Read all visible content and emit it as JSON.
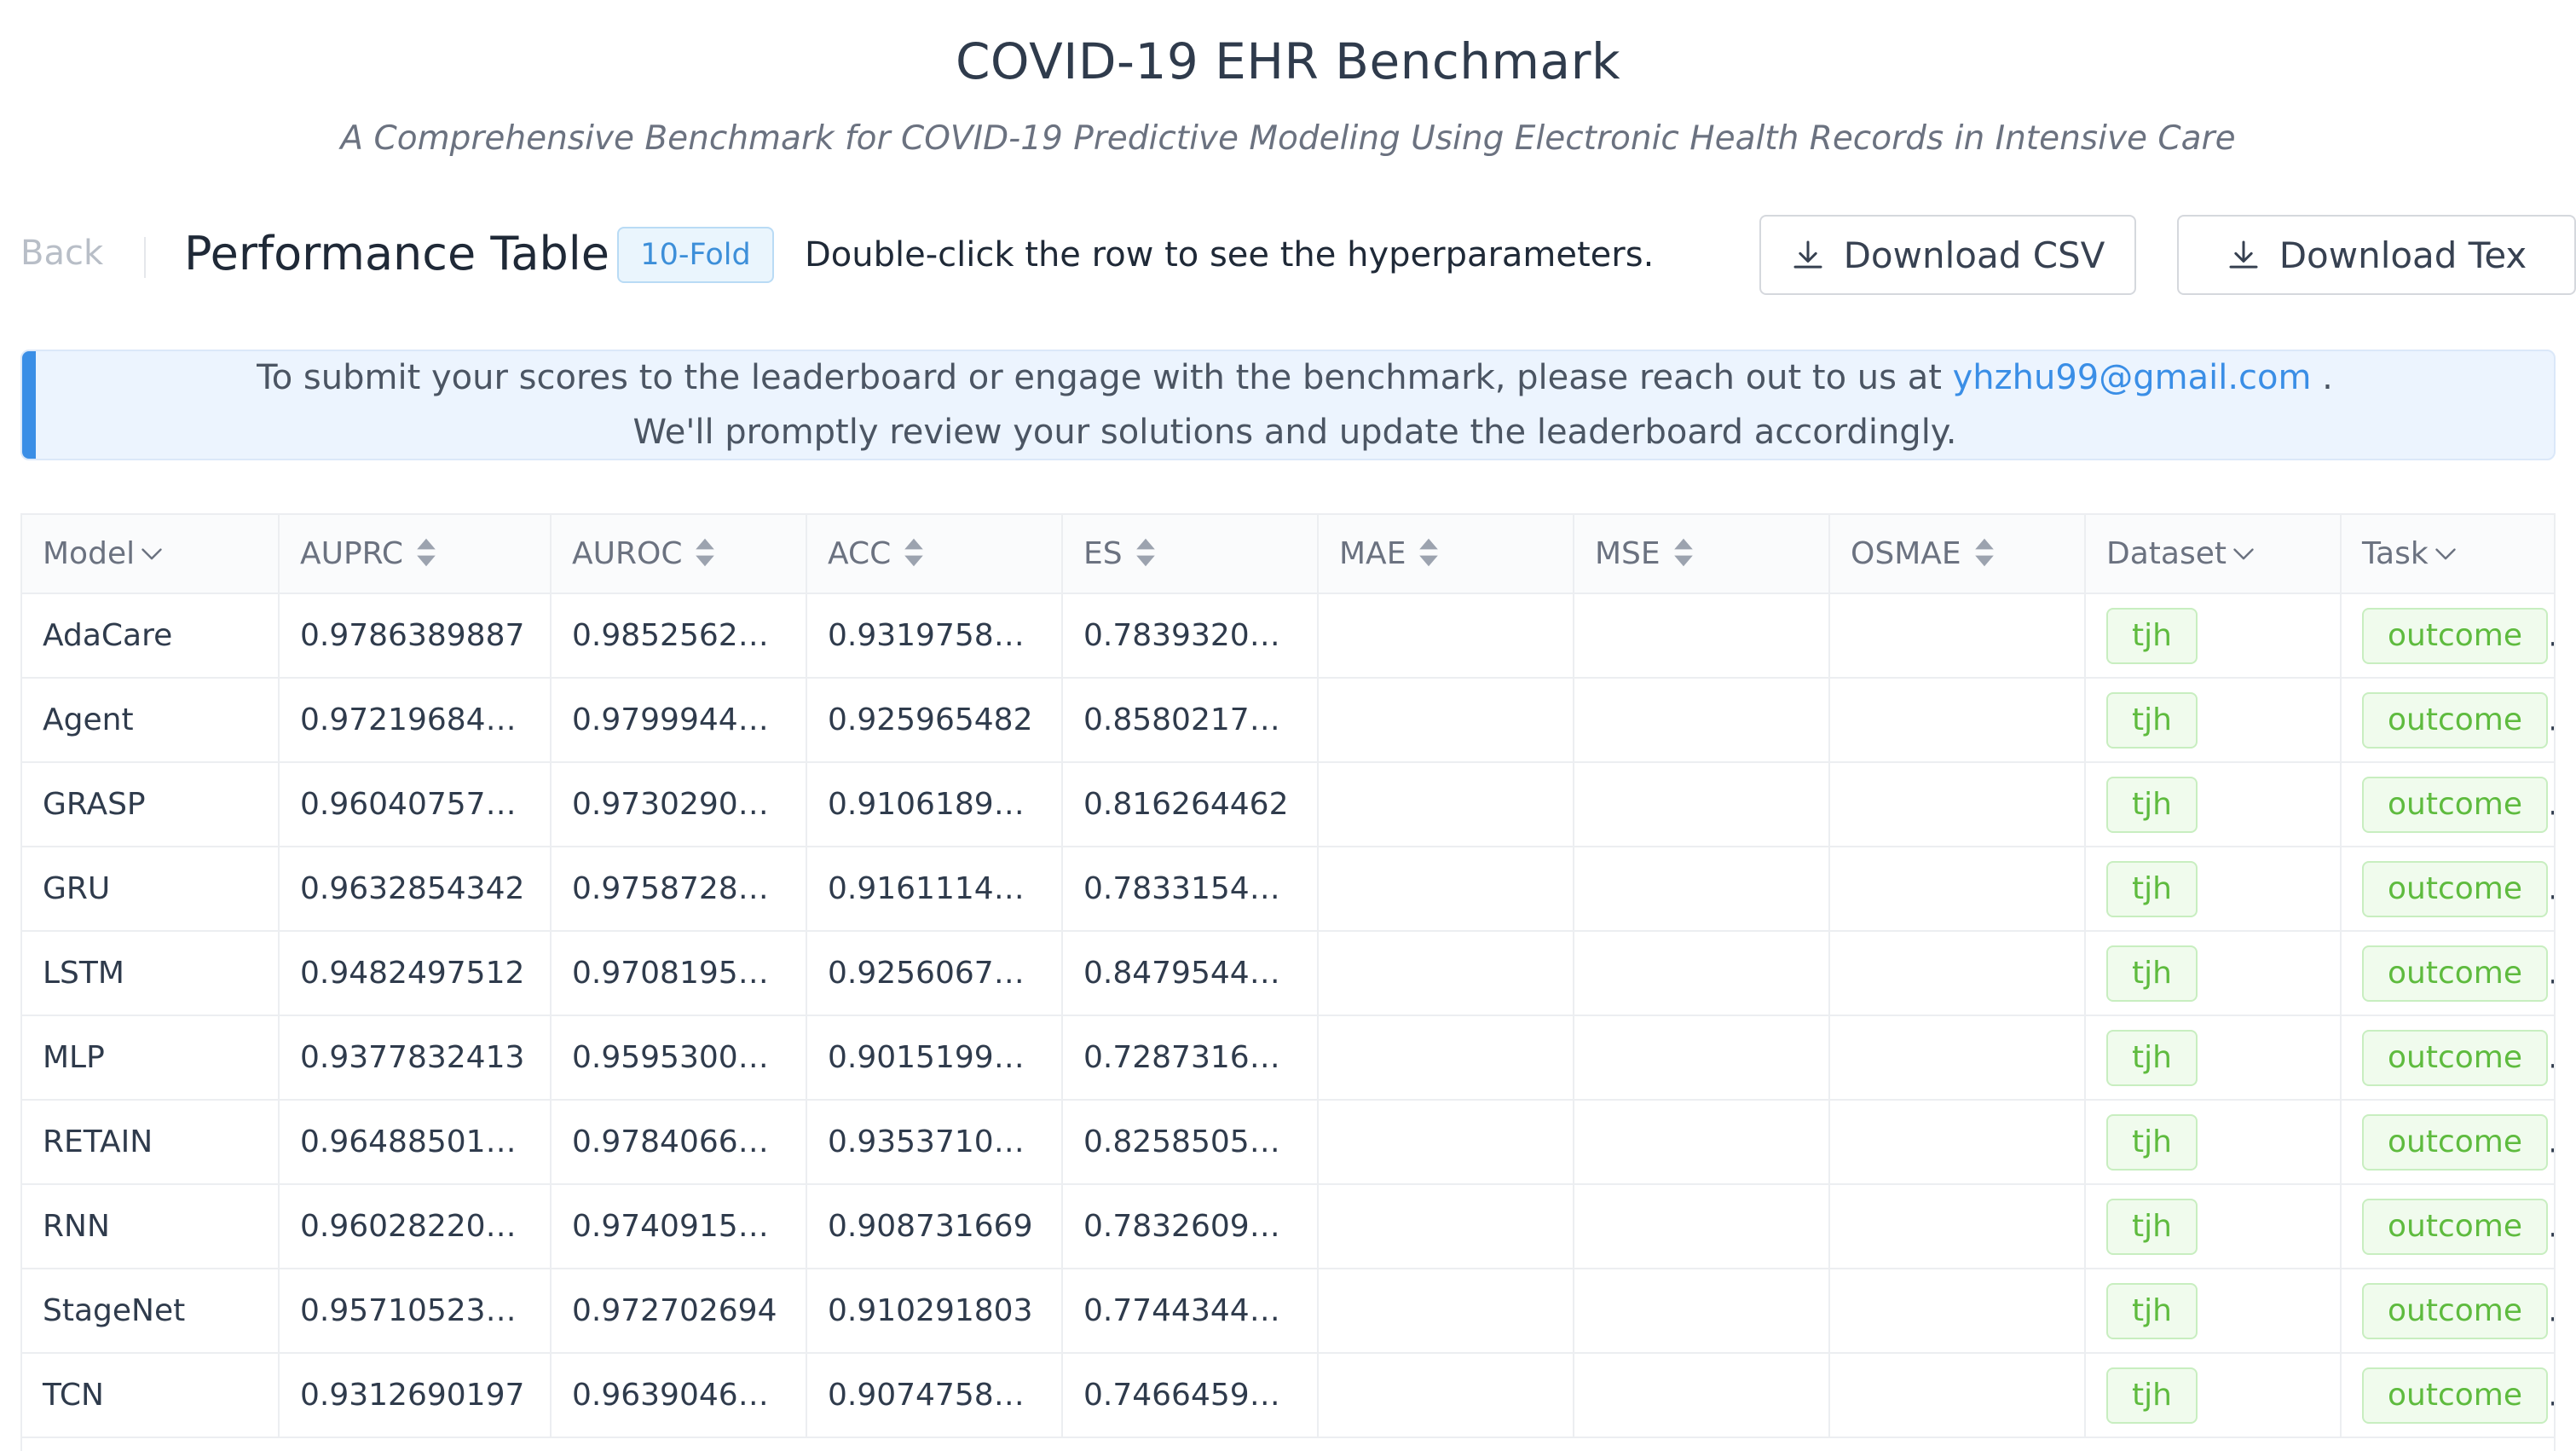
{
  "header": {
    "title": "COVID-19 EHR Benchmark",
    "subtitle": "A Comprehensive Benchmark for COVID-19 Predictive Modeling Using Electronic Health Records in Intensive Care"
  },
  "toolbar": {
    "back_label": "Back",
    "page_title": "Performance Table",
    "fold_badge": "10-Fold",
    "hint": "Double-click the row to see the hyperparameters.",
    "download_csv": "Download CSV",
    "download_tex": "Download Tex"
  },
  "notice": {
    "line1_prefix": "To submit your scores to the leaderboard or engage with the benchmark, please reach out to us at",
    "email": "yhzhu99@gmail.com",
    "line1_suffix": " .",
    "line2": "We'll promptly review your solutions and update the leaderboard accordingly."
  },
  "table": {
    "columns": [
      {
        "label": "Model",
        "control": "filter"
      },
      {
        "label": "AUPRC",
        "control": "sort"
      },
      {
        "label": "AUROC",
        "control": "sort"
      },
      {
        "label": "ACC",
        "control": "sort"
      },
      {
        "label": "ES",
        "control": "sort"
      },
      {
        "label": "MAE",
        "control": "sort"
      },
      {
        "label": "MSE",
        "control": "sort"
      },
      {
        "label": "OSMAE",
        "control": "sort"
      },
      {
        "label": "Dataset",
        "control": "filter"
      },
      {
        "label": "Task",
        "control": "filter"
      }
    ],
    "rows": [
      {
        "model": "AdaCare",
        "auprc": "0.9786389887",
        "auroc": "0.98525629...",
        "acc": "0.931975859...",
        "es": "0.783932087...",
        "mae": "",
        "mse": "",
        "osmae": "",
        "dataset": "tjh",
        "task": "outcome"
      },
      {
        "model": "Agent",
        "auprc": "0.9721968413...",
        "auroc": "0.979994475...",
        "acc": "0.925965482",
        "es": "0.8580217808",
        "mae": "",
        "mse": "",
        "osmae": "",
        "dataset": "tjh",
        "task": "outcome"
      },
      {
        "model": "GRASP",
        "auprc": "0.960407572...",
        "auroc": "0.97302908...",
        "acc": "0.9106189788",
        "es": "0.816264462",
        "mae": "",
        "mse": "",
        "osmae": "",
        "dataset": "tjh",
        "task": "outcome"
      },
      {
        "model": "GRU",
        "auprc": "0.9632854342",
        "auroc": "0.975872808...",
        "acc": "0.9161114095",
        "es": "0.7833154328",
        "mae": "",
        "mse": "",
        "osmae": "",
        "dataset": "tjh",
        "task": "outcome"
      },
      {
        "model": "LSTM",
        "auprc": "0.9482497512",
        "auroc": "0.970819514...",
        "acc": "0.92560674...",
        "es": "0.847954467...",
        "mae": "",
        "mse": "",
        "osmae": "",
        "dataset": "tjh",
        "task": "outcome"
      },
      {
        "model": "MLP",
        "auprc": "0.9377832413",
        "auroc": "0.95953007...",
        "acc": "0.9015199959",
        "es": "0.728731624...",
        "mae": "",
        "mse": "",
        "osmae": "",
        "dataset": "tjh",
        "task": "outcome"
      },
      {
        "model": "RETAIN",
        "auprc": "0.9648850143...",
        "auroc": "0.978406661...",
        "acc": "0.9353710175",
        "es": "0.82585054...",
        "mae": "",
        "mse": "",
        "osmae": "",
        "dataset": "tjh",
        "task": "outcome"
      },
      {
        "model": "RNN",
        "auprc": "0.960282206...",
        "auroc": "0.974091505...",
        "acc": "0.908731669",
        "es": "0.78326098...",
        "mae": "",
        "mse": "",
        "osmae": "",
        "dataset": "tjh",
        "task": "outcome"
      },
      {
        "model": "StageNet",
        "auprc": "0.9571052372...",
        "auroc": "0.972702694",
        "acc": "0.910291803",
        "es": "0.7744344511...",
        "mae": "",
        "mse": "",
        "osmae": "",
        "dataset": "tjh",
        "task": "outcome"
      },
      {
        "model": "TCN",
        "auprc": "0.9312690197",
        "auroc": "0.96390466...",
        "acc": "0.907475847...",
        "es": "0.7466459729",
        "mae": "",
        "mse": "",
        "osmae": "",
        "dataset": "tjh",
        "task": "outcome"
      }
    ]
  },
  "icons": {
    "download": "download-icon",
    "sort": "sort-caret-icon",
    "filter": "chevron-down-icon"
  },
  "colors": {
    "accent": "#3a8ee6",
    "tag_green": "#5ebb3e",
    "badge_blue": "#3d8fd9"
  }
}
